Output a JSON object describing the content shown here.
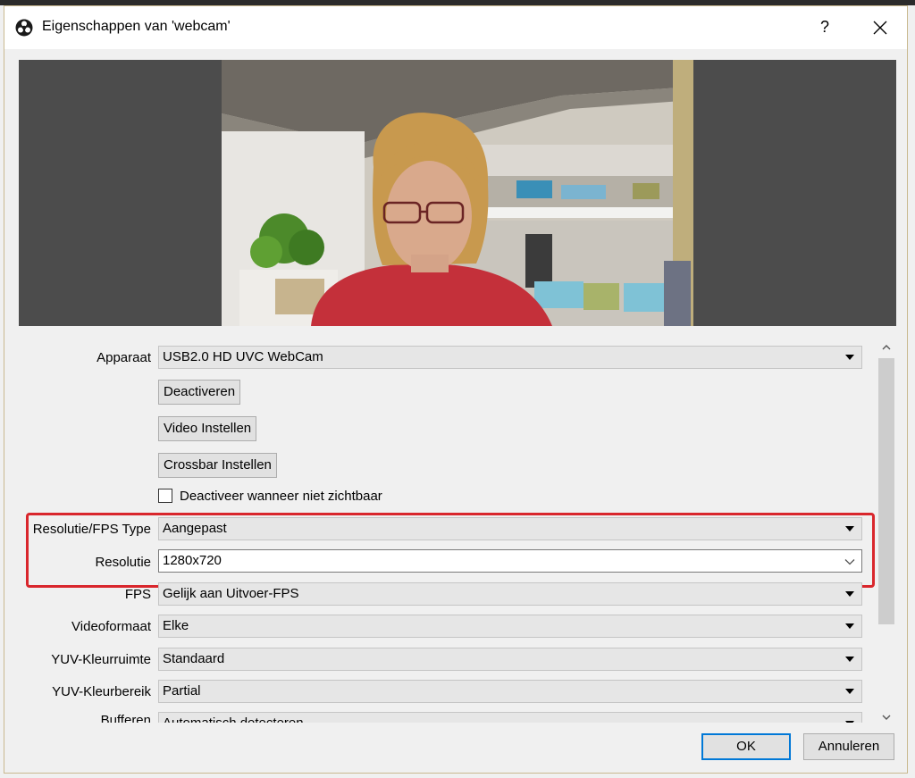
{
  "window": {
    "title": "Eigenschappen van 'webcam'",
    "help_label": "?"
  },
  "properties": {
    "device": {
      "label": "Apparaat",
      "value": "USB2.0 HD UVC WebCam"
    },
    "deactivate_button": "Deactiveren",
    "video_config_button": "Video Instellen",
    "crossbar_button": "Crossbar Instellen",
    "deactivate_when_hidden": {
      "label": "Deactiveer wanneer niet zichtbaar",
      "checked": false
    },
    "res_fps_type": {
      "label": "Resolutie/FPS Type",
      "value": "Aangepast"
    },
    "resolution": {
      "label": "Resolutie",
      "value": "1280x720"
    },
    "fps": {
      "label": "FPS",
      "value": "Gelijk aan Uitvoer-FPS"
    },
    "video_format": {
      "label": "Videoformaat",
      "value": "Elke"
    },
    "yuv_color_space": {
      "label": "YUV-Kleurruimte",
      "value": "Standaard"
    },
    "yuv_color_range": {
      "label": "YUV-Kleurbereik",
      "value": "Partial"
    },
    "buffering": {
      "label": "Bufferen",
      "value": "Automatisch detecteren"
    }
  },
  "buttons": {
    "ok": "OK",
    "cancel": "Annuleren"
  },
  "colors": {
    "highlight": "#d9262c",
    "accent": "#0078d7"
  }
}
